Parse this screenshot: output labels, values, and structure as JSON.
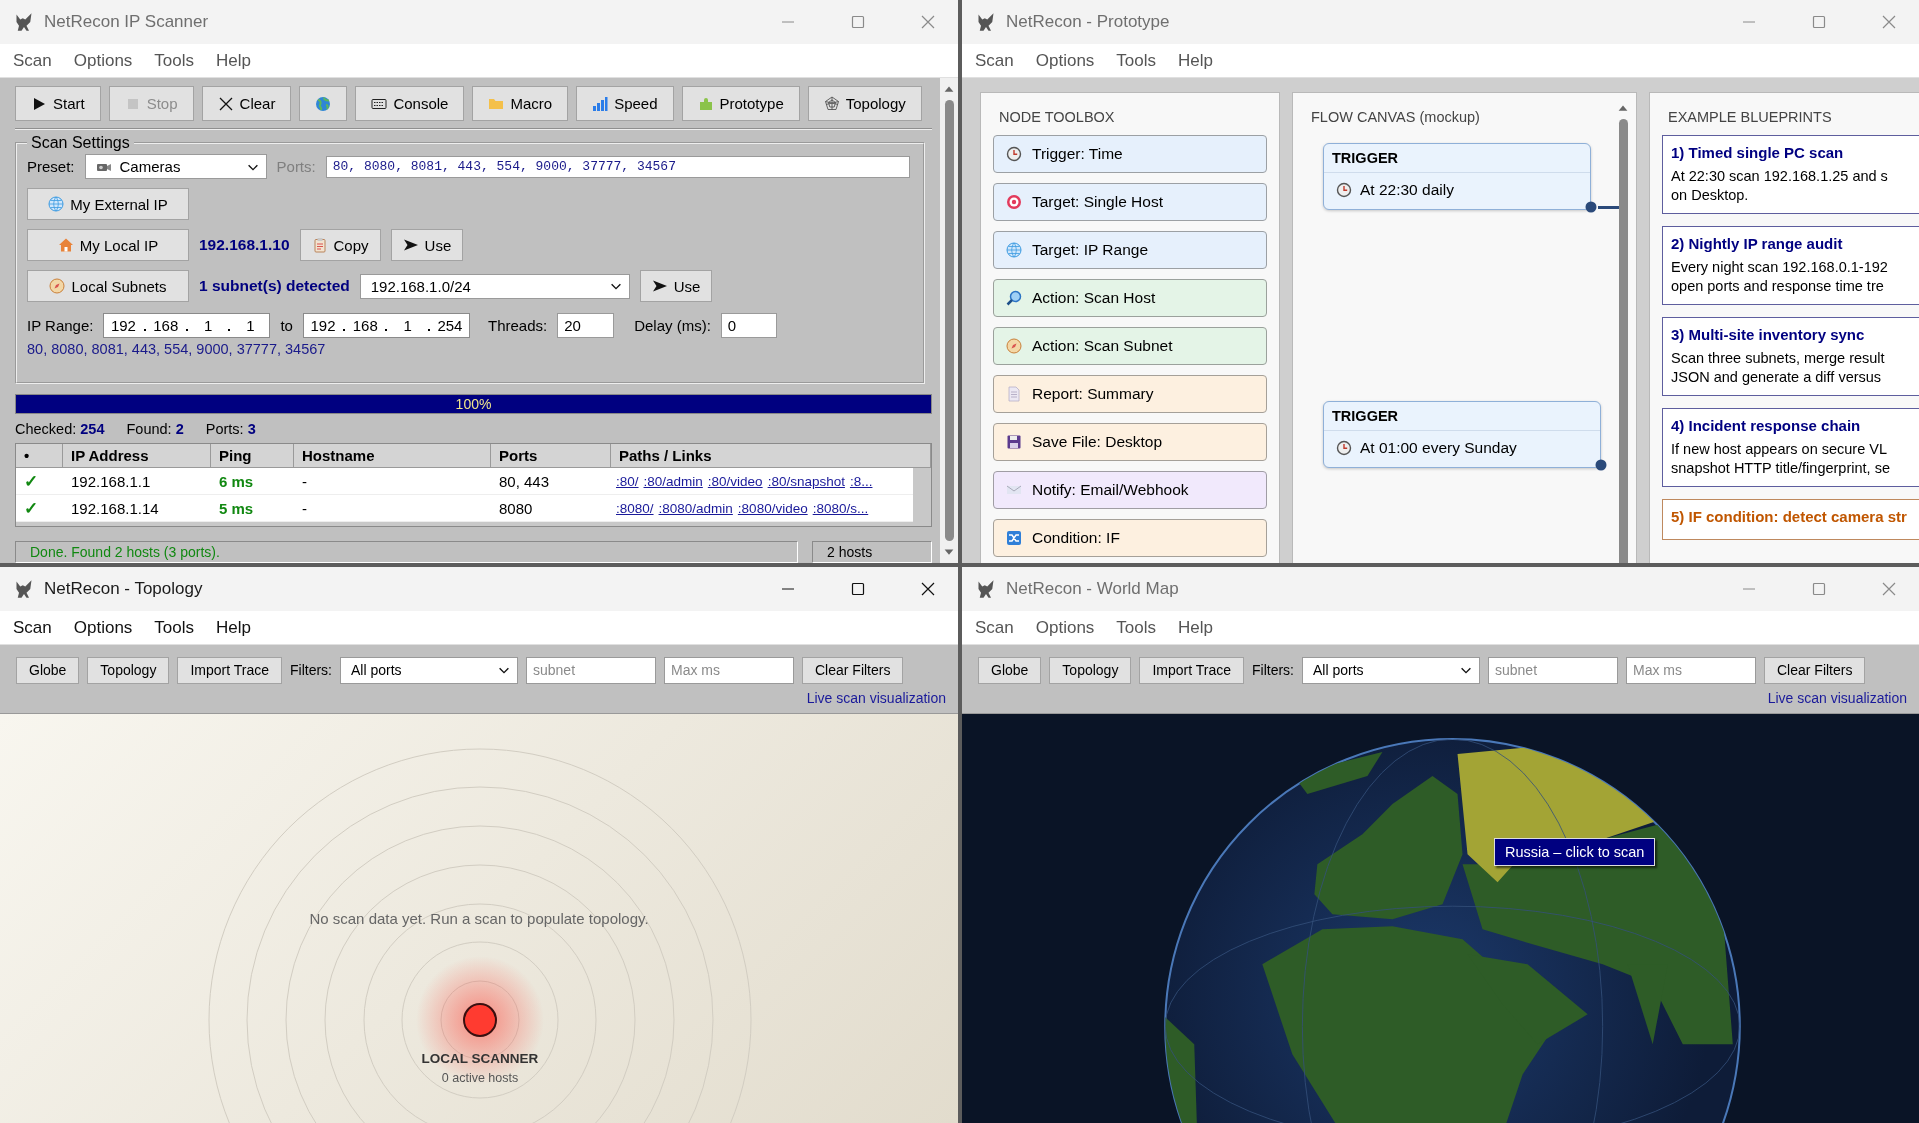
{
  "windows": [
    {
      "kind": "scanner",
      "title": "NetRecon IP Scanner",
      "active": false,
      "menu": [
        "Scan",
        "Options",
        "Tools",
        "Help"
      ],
      "toolbar": [
        {
          "label": "Start",
          "disabled": false
        },
        {
          "label": "Stop",
          "disabled": true
        },
        {
          "label": "Clear",
          "disabled": false
        },
        {
          "disabled": false
        },
        {
          "label": "Console",
          "disabled": false
        },
        {
          "label": "Macro",
          "disabled": false
        },
        {
          "label": "Speed",
          "disabled": false
        },
        {
          "label": "Prototype",
          "disabled": false
        },
        {
          "label": "Topology",
          "disabled": false
        }
      ],
      "settings": {
        "title": "Scan Settings",
        "preset_label": "Preset:",
        "preset": "Cameras",
        "ports_label": "Ports:",
        "ports": "80, 8080, 8081, 443, 554, 9000, 37777, 34567",
        "external_ip_button": "My External IP",
        "local_ip_button": "My Local IP",
        "local_ip": "192.168.1.10",
        "copy_button": "Copy",
        "use_button": "Use",
        "subnets_button": "Local Subnets",
        "subnets_detected": "1 subnet(s) detected",
        "subnet": "192.168.1.0/24",
        "subnet_use_button": "Use",
        "ip_range_label": "IP Range:",
        "range_from": [
          "192",
          "168",
          "1",
          "1"
        ],
        "to_label": "to",
        "range_to": [
          "192",
          "168",
          "1",
          "254"
        ],
        "threads_label": "Threads:",
        "threads": "20",
        "delay_label": "Delay (ms):",
        "delay": "0",
        "ports_summary": "80, 8080, 8081, 443, 554, 9000, 37777, 34567"
      },
      "progress": {
        "level": 1,
        "text": "100%"
      },
      "stats": [
        "Checked: **254**",
        "Found: **2**",
        "Ports: **3**"
      ],
      "table": {
        "columns": [
          "•",
          "IP Address",
          "Ping",
          "Hostname",
          "Ports",
          "Paths / Links"
        ],
        "rows": [
          {
            "status": "✓",
            "ip": "192.168.1.1",
            "ping": "6 ms",
            "hostname": "-",
            "ports": "80, 443",
            "links": [
              ":80/",
              ":80/admin",
              ":80/video",
              ":80/snapshot",
              ":8..."
            ]
          },
          {
            "status": "✓",
            "ip": "192.168.1.14",
            "ping": "5 ms",
            "hostname": "-",
            "ports": "8080",
            "links": [
              ":8080/",
              ":8080/admin",
              ":8080/video",
              ":8080/s..."
            ]
          }
        ]
      },
      "status_bar": {
        "message": "Done. Found 2 hosts (3 ports).",
        "hosts": "2 hosts"
      }
    },
    {
      "kind": "prototype",
      "title": "NetRecon - Prototype",
      "active": false,
      "menu": [
        "Scan",
        "Options",
        "Tools",
        "Help"
      ],
      "toolbox": {
        "title": "NODE TOOLBOX",
        "items": [
          {
            "label": "Trigger: Time",
            "color": "#e6f0fc"
          },
          {
            "label": "Target: Single Host",
            "color": "#e6f0fc"
          },
          {
            "label": "Target: IP Range",
            "color": "#e6f0fc"
          },
          {
            "label": "Action: Scan Host",
            "color": "#e4f4e7"
          },
          {
            "label": "Action: Scan Subnet",
            "color": "#e4f4e7"
          },
          {
            "label": "Report: Summary",
            "color": "#fdf0e0"
          },
          {
            "label": "Save File: Desktop",
            "color": "#fdf0e0"
          },
          {
            "label": "Notify: Email/Webhook",
            "color": "#f1e9fc"
          },
          {
            "label": "Condition: IF",
            "color": "#fdf0e0"
          }
        ]
      },
      "canvas": {
        "title": "FLOW CANVAS (mockup)",
        "nodes": [
          {
            "header": "TRIGGER",
            "text": "At 22:30 daily"
          },
          {
            "header": "TRIGGER",
            "text": "At 01:00 every Sunday"
          }
        ]
      },
      "blueprints": {
        "title": "EXAMPLE BLUEPRINTS",
        "items": [
          {
            "title": "1) Timed single PC scan",
            "color": "#000080",
            "lines": [
              "At 22:30 scan 192.168.1.25 and s",
              "on Desktop."
            ]
          },
          {
            "title": "2) Nightly IP range audit",
            "color": "#000080",
            "lines": [
              "Every night scan 192.168.0.1-192",
              "open ports and response time tre"
            ]
          },
          {
            "title": "3) Multi-site inventory sync",
            "color": "#000080",
            "lines": [
              "Scan three subnets, merge result",
              "JSON and generate a diff versus"
            ]
          },
          {
            "title": "4) Incident response chain",
            "color": "#000080",
            "lines": [
              "If new host appears on secure VL",
              "snapshot HTTP title/fingerprint, se"
            ]
          },
          {
            "title": "5) IF condition: detect camera str",
            "color": "#c05600"
          }
        ]
      }
    },
    {
      "kind": "topology",
      "title": "NetRecon - Topology",
      "active": true,
      "menu": [
        "Scan",
        "Options",
        "Tools",
        "Help"
      ],
      "toolbar": {
        "buttons": [
          "Globe",
          "Topology",
          "Import Trace"
        ],
        "filters_label": "Filters:",
        "filter": "All ports",
        "fields": [
          {
            "placeholder": "subnet"
          },
          {
            "placeholder": "Max ms"
          }
        ],
        "clear_button": "Clear Filters",
        "link": "Live scan visualization"
      },
      "canvas": {
        "message": "No scan data yet. Run a scan to populate topology.",
        "node_label": "LOCAL SCANNER",
        "node_caption": "0 active hosts"
      }
    },
    {
      "kind": "worldmap",
      "title": "NetRecon - World Map",
      "active": false,
      "menu": [
        "Scan",
        "Options",
        "Tools",
        "Help"
      ],
      "toolbar": {
        "buttons": [
          "Globe",
          "Topology",
          "Import Trace"
        ],
        "filters_label": "Filters:",
        "filter": "All ports",
        "fields": [
          {
            "placeholder": "subnet"
          },
          {
            "placeholder": "Max ms"
          }
        ],
        "clear_button": "Clear Filters",
        "link": "Live scan visualization"
      },
      "map": {
        "kind": "picture",
        "tooltip": "Russia – click to scan"
      }
    }
  ]
}
